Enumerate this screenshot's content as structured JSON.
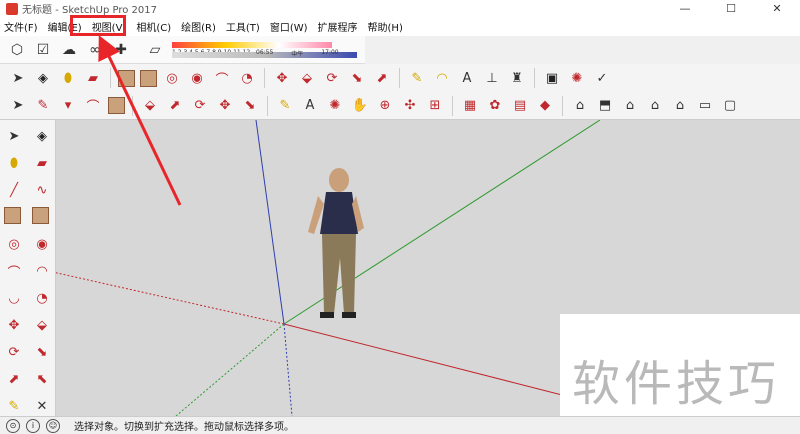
{
  "window": {
    "title": "无标题 - SketchUp Pro 2017",
    "min": "—",
    "max": "☐",
    "close": "✕"
  },
  "menu": [
    {
      "label": "文件(F)"
    },
    {
      "label": "编辑(E)"
    },
    {
      "label": "视图(V)"
    },
    {
      "label": "相机(C)"
    },
    {
      "label": "绘图(R)"
    },
    {
      "label": "工具(T)"
    },
    {
      "label": "窗口(W)"
    },
    {
      "label": "扩展程序"
    },
    {
      "label": "帮助(H)"
    }
  ],
  "shadow": {
    "months": "1 2 3 4 5 6 7 8 9 10 11 12",
    "time_start": "06:55",
    "time_mid": "中午",
    "time_end": "17:00"
  },
  "status": {
    "text": "选择对象。切换到扩充选择。拖动鼠标选择多项。"
  },
  "watermark": "软件技巧",
  "colors": {
    "highlight": "#e8262a",
    "axis_red": "#c0282d",
    "axis_green": "#2e9a2e",
    "axis_blue": "#2f3fae"
  }
}
